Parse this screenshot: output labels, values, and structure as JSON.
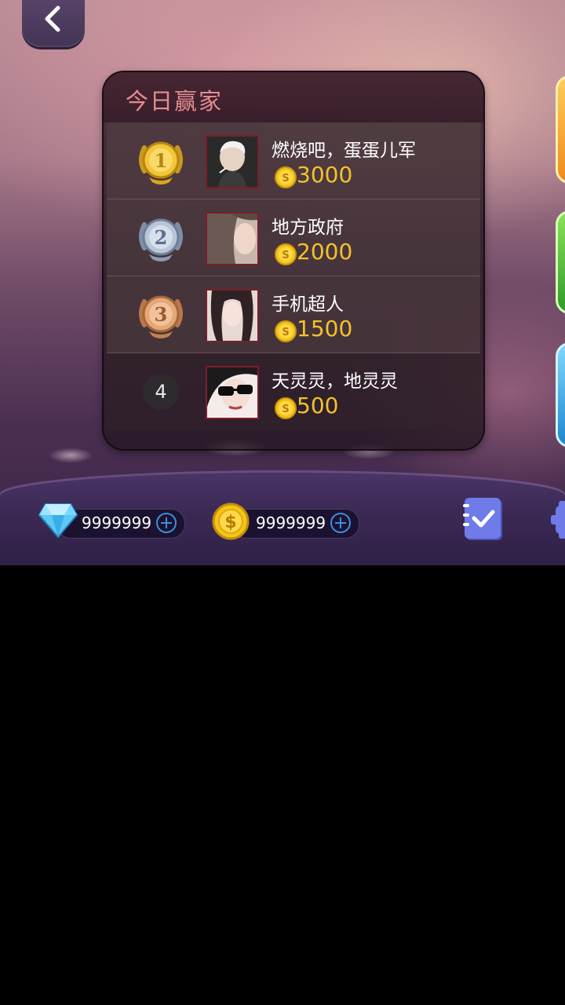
{
  "panel": {
    "title": "今日赢家"
  },
  "rankings": [
    {
      "rank": "1",
      "name": "燃烧吧，蛋蛋儿军",
      "score": "3000",
      "medal": "gold-medal-icon"
    },
    {
      "rank": "2",
      "name": "地方政府",
      "score": "2000",
      "medal": "silver-medal-icon"
    },
    {
      "rank": "3",
      "name": "手机超人",
      "score": "1500",
      "medal": "bronze-medal-icon"
    },
    {
      "rank": "4",
      "name": "天灵灵，地灵灵",
      "score": "500",
      "medal": null
    }
  ],
  "resources": {
    "diamonds": "9999999",
    "gold": "9999999"
  },
  "icons": {
    "back": "back-arrow-icon",
    "diamond": "diamond-icon",
    "gold": "gold-coin-icon",
    "plus": "plus-circle-icon",
    "tasks": "task-checklist-icon",
    "settings": "gear-icon"
  },
  "colors": {
    "title": "#e98b93",
    "score": "#f3c22a",
    "plus": "#3d8de0",
    "task": "#6b76e0"
  }
}
